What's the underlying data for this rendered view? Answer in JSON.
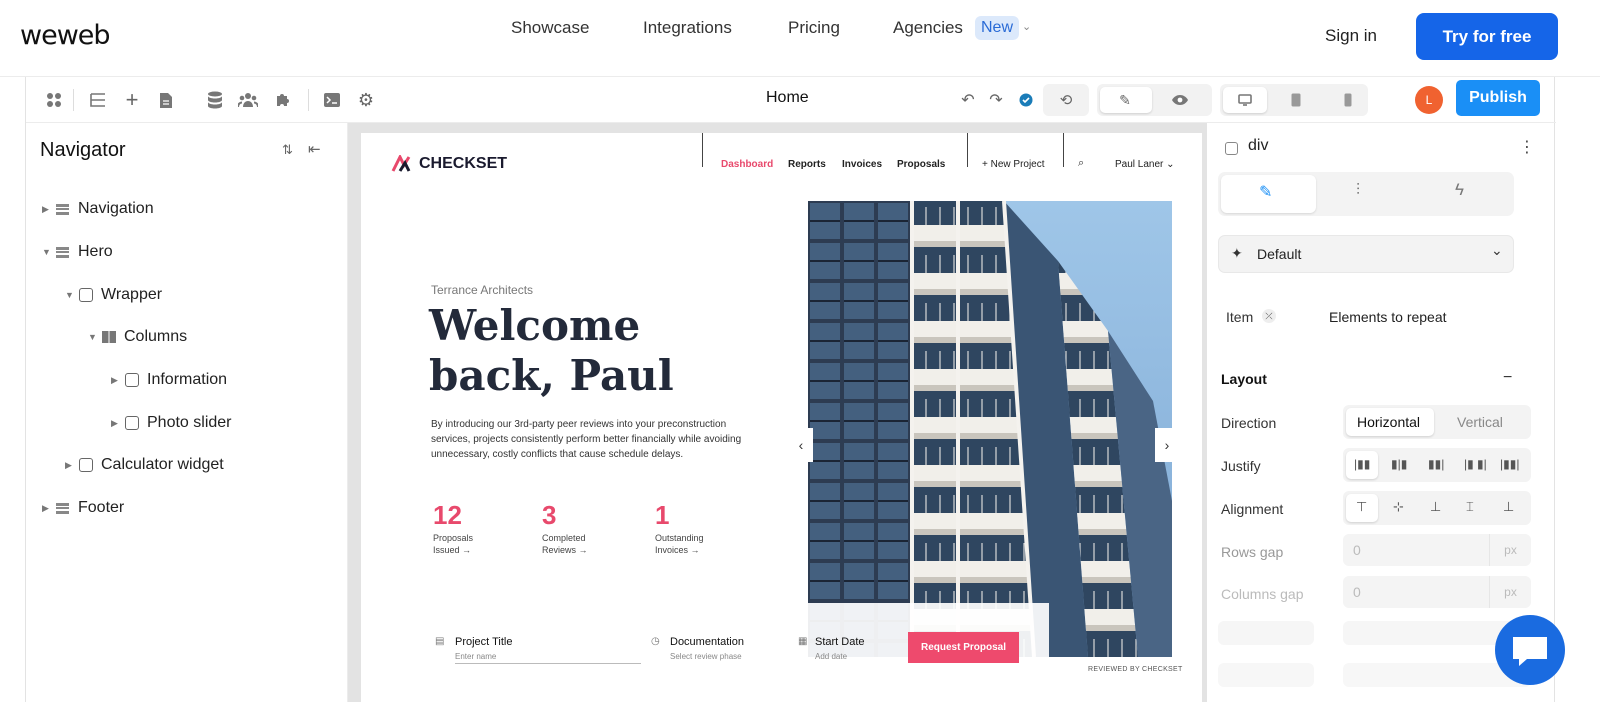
{
  "site": {
    "logo": "weweb",
    "nav": [
      "Showcase",
      "Integrations",
      "Pricing",
      "Agencies"
    ],
    "new_badge": "New",
    "sign_in": "Sign in",
    "cta": "Try for free"
  },
  "editor": {
    "page_name": "Home",
    "avatar_initial": "L",
    "publish": "Publish",
    "accent": "#1a8ff6"
  },
  "navigator": {
    "title": "Navigator",
    "items": [
      "Navigation",
      "Hero",
      "Wrapper",
      "Columns",
      "Information",
      "Photo slider",
      "Calculator widget",
      "Footer"
    ]
  },
  "canvas": {
    "brand": "CHECKSET",
    "nav": [
      "Dashboard",
      "Reports",
      "Invoices",
      "Proposals"
    ],
    "new_project": "+ New Project",
    "user": "Paul Laner ⌄",
    "eyebrow": "Terrance Architects",
    "heading": "Welcome back, Paul",
    "paragraph": "By introducing our 3rd-party peer reviews into your preconstruction services, projects consistently perform better financially while avoiding unnecessary, costly conflicts that cause schedule delays.",
    "stats": [
      {
        "value": "12",
        "label1": "Proposals",
        "label2": "Issued →"
      },
      {
        "value": "3",
        "label1": "Completed",
        "label2": "Reviews →"
      },
      {
        "value": "1",
        "label1": "Outstanding",
        "label2": "Invoices →"
      }
    ],
    "form": {
      "project_title": "Project Title",
      "project_placeholder": "Enter name",
      "documentation": "Documentation",
      "documentation_sub": "Select review phase",
      "start_date": "Start Date",
      "start_sub": "Add date",
      "button": "Request Proposal"
    },
    "reviewed": "REVIEWED BY CHECKSET"
  },
  "panel": {
    "element": "div",
    "state": "Default",
    "item_label": "Item",
    "item_value": "Elements to repeat",
    "layout_title": "Layout",
    "direction_label": "Direction",
    "direction_options": [
      "Horizontal",
      "Vertical"
    ],
    "justify_label": "Justify",
    "alignment_label": "Alignment",
    "rows_gap_label": "Rows gap",
    "rows_gap_value": "0",
    "columns_gap_label": "Columns gap",
    "columns_gap_value": "0",
    "unit": "px"
  }
}
